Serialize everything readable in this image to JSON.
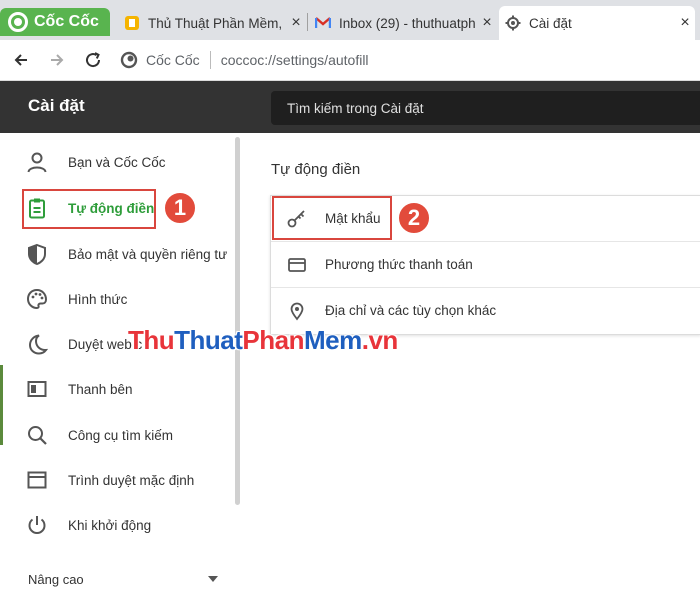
{
  "browser": {
    "brand_label": "Cốc Cốc",
    "tabs": [
      {
        "title": "Thủ Thuật Phần Mềm, ...",
        "icon": "tab-favicon-icon"
      },
      {
        "title": "Inbox (29) - thuthuatph",
        "icon": "gmail-icon"
      },
      {
        "title": "Cài đặt",
        "icon": "gear-icon"
      }
    ],
    "close_glyph": "×",
    "omnibox": {
      "site": "Cốc Cốc",
      "url": "coccoc://settings/autofill"
    }
  },
  "header": {
    "title": "Cài đặt",
    "search_placeholder": "Tìm kiếm trong Cài đặt"
  },
  "sidebar": {
    "items": [
      {
        "label": "Bạn và Cốc Cốc",
        "icon": "person-icon"
      },
      {
        "label": "Tự động điền",
        "icon": "clipboard-icon",
        "active": true
      },
      {
        "label": "Bảo mật và quyền riêng tư",
        "icon": "shield-icon"
      },
      {
        "label": "Hình thức",
        "icon": "palette-icon"
      },
      {
        "label": "Duyệt web c",
        "icon": "moon-icon"
      },
      {
        "label": "Thanh bên",
        "icon": "sidebar-panel-icon"
      },
      {
        "label": "Công cụ tìm kiếm",
        "icon": "search-icon"
      },
      {
        "label": "Trình duyệt mặc định",
        "icon": "browser-window-icon"
      },
      {
        "label": "Khi khởi động",
        "icon": "power-icon"
      }
    ],
    "advanced_label": "Nâng cao"
  },
  "main": {
    "section_title": "Tự động điền",
    "rows": [
      {
        "label": "Mật khẩu",
        "icon": "key-icon"
      },
      {
        "label": "Phương thức thanh toán",
        "icon": "credit-card-icon"
      },
      {
        "label": "Địa chỉ và các tùy chọn khác",
        "icon": "location-pin-icon"
      }
    ]
  },
  "annotations": {
    "step1": "1",
    "step2": "2"
  },
  "watermark": {
    "part1": "Thu",
    "part2": "Thuat",
    "part3": "Phan",
    "part4": "Mem",
    "part5": ".vn"
  },
  "colors": {
    "accent_green": "#2e9d3a",
    "annotation_red": "#e24b3b",
    "header_bg": "#333333"
  }
}
